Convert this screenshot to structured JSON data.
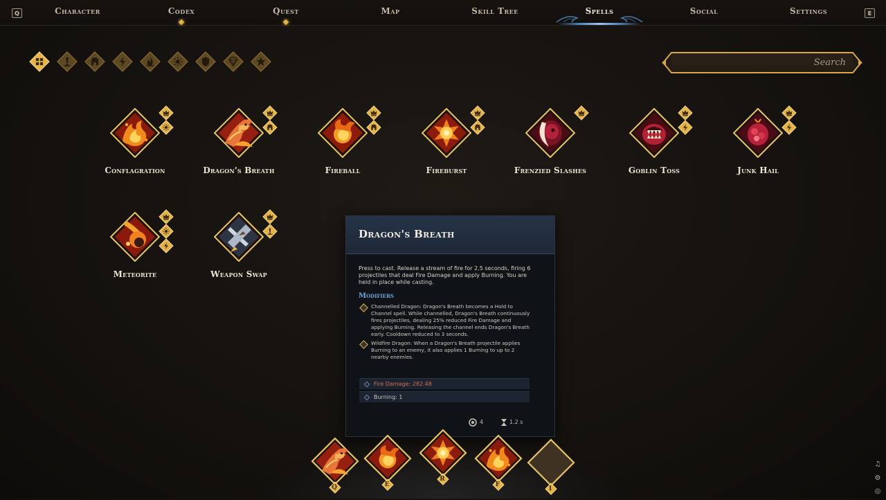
{
  "nav": {
    "left_key": "Q",
    "right_key": "E",
    "tabs": [
      {
        "label": "Character",
        "notify": false,
        "active": false
      },
      {
        "label": "Codex",
        "notify": true,
        "active": false
      },
      {
        "label": "Quest",
        "notify": true,
        "active": false
      },
      {
        "label": "Map",
        "notify": false,
        "active": false
      },
      {
        "label": "Skill Tree",
        "notify": false,
        "active": false
      },
      {
        "label": "Spells",
        "notify": false,
        "active": true
      },
      {
        "label": "Social",
        "notify": false,
        "active": false
      },
      {
        "label": "Settings",
        "notify": false,
        "active": false
      }
    ]
  },
  "filters": [
    {
      "icon": "grid-icon",
      "selected": true
    },
    {
      "icon": "exclamation-icon",
      "selected": false
    },
    {
      "icon": "helmet-icon",
      "selected": false
    },
    {
      "icon": "lightning-icon",
      "selected": false
    },
    {
      "icon": "flame-icon",
      "selected": false
    },
    {
      "icon": "sun-icon",
      "selected": false
    },
    {
      "icon": "shield-icon",
      "selected": false
    },
    {
      "icon": "gem-icon",
      "selected": false
    },
    {
      "icon": "star-icon",
      "selected": false
    }
  ],
  "search": {
    "placeholder": "Search"
  },
  "spells": [
    {
      "name": "Conflagration",
      "art": "fire",
      "badges": [
        "crown-icon",
        "sun-icon"
      ]
    },
    {
      "name": "Dragon's Breath",
      "art": "dragon",
      "badges": [
        "crown-icon",
        "helmet-icon"
      ]
    },
    {
      "name": "Fireball",
      "art": "fireball",
      "badges": [
        "crown-icon",
        "helmet-icon"
      ]
    },
    {
      "name": "Fireburst",
      "art": "burst",
      "badges": [
        "crown-icon",
        "helmet-icon"
      ]
    },
    {
      "name": "Frenzied Slashes",
      "art": "slash",
      "badges": [
        "crown-icon"
      ]
    },
    {
      "name": "Goblin Toss",
      "art": "goblin",
      "badges": [
        "crown-icon",
        "lightning-icon"
      ]
    },
    {
      "name": "Junk Hail",
      "art": "junk",
      "badges": [
        "crown-icon",
        "lightning-icon"
      ]
    },
    {
      "name": "Meteorite",
      "art": "meteor",
      "badges": [
        "crown-icon",
        "sun-icon",
        "lightning-icon"
      ]
    },
    {
      "name": "Weapon Swap",
      "art": "swap",
      "badges": [
        "crown-icon",
        "exclamation-icon"
      ]
    }
  ],
  "tooltip": {
    "title": "Dragon's Breath",
    "description": "Press to cast. Release a stream of fire for 2.5 seconds, firing 6 projectiles that deal Fire Damage and apply Burning. You are held in place while casting.",
    "modifiers_title": "Modifiers",
    "modifiers": [
      "Channelled Dragon: Dragon's Breath becomes a Hold to Channel spell. While channelled, Dragon's Breath continuously fires projectiles, dealing 25% reduced Fire Damage and applying Burning. Releasing the channel ends Dragon's Breath early. Cooldown reduced to 3 seconds.",
      "Wildfire Dragon: When a Dragon's Breath projectile applies Burning to an enemy, it also applies 1 Burning to up to 2 nearby enemies."
    ],
    "stats": [
      {
        "text": "Fire Damage: 282.48",
        "color": "#d86b4c"
      },
      {
        "text": "Burning: 1",
        "color": "#c8c4bb"
      }
    ],
    "footer": {
      "charges": "4",
      "cooldown": "1.2 s"
    }
  },
  "hotbar": [
    {
      "key": "Q",
      "art": "dragon",
      "filled": true
    },
    {
      "key": "E",
      "art": "fireball",
      "filled": true
    },
    {
      "key": "R",
      "art": "burst",
      "filled": true
    },
    {
      "key": "F",
      "art": "fire",
      "filled": true
    },
    {
      "key": "1",
      "art": "empty",
      "filled": false
    }
  ],
  "colors": {
    "gold": "#e3b248",
    "accent_blue": "#6fa6de",
    "spell_red": "#9b1f12",
    "fire_damage": "#d86b4c"
  }
}
